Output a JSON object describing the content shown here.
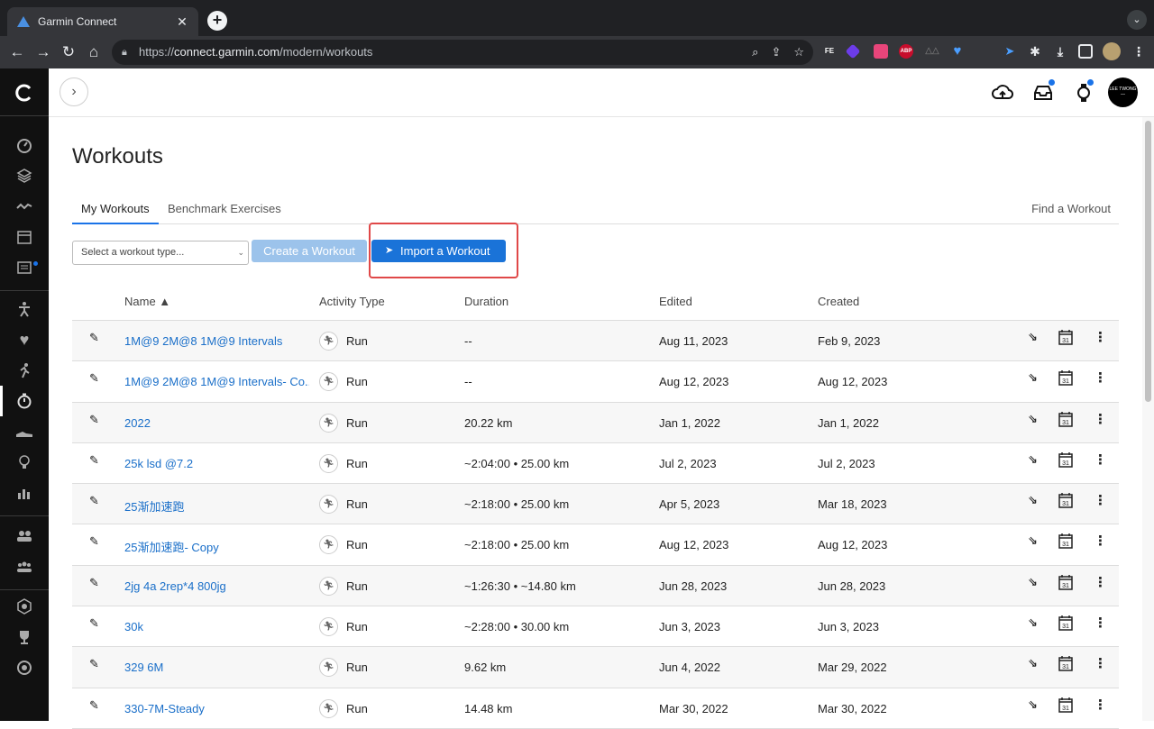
{
  "browser": {
    "tab_title": "Garmin Connect",
    "url_scheme": "https://",
    "url_host": "connect.garmin.com",
    "url_path": "/modern/workouts",
    "extensions": [
      {
        "name": "fe-extension-icon",
        "text": "FE",
        "color": "#d93025"
      },
      {
        "name": "purple-extension-icon",
        "text": "",
        "color": "#6c3ce9"
      },
      {
        "name": "pink-extension-icon",
        "text": "",
        "color": "#e8457a"
      },
      {
        "name": "abp-extension-icon",
        "text": "ABP",
        "color": "#c70d2c"
      }
    ]
  },
  "header": {
    "avatar_text": "LEE TWONG"
  },
  "page": {
    "title": "Workouts",
    "tabs": [
      {
        "label": "My Workouts",
        "active": true
      },
      {
        "label": "Benchmark Exercises",
        "active": false
      }
    ],
    "find_link": "Find a Workout",
    "type_select_placeholder": "Select a workout type...",
    "create_button": "Create a Workout",
    "import_button": "Import a Workout"
  },
  "table": {
    "columns": [
      "Name ▲",
      "Activity Type",
      "Duration",
      "Edited",
      "Created"
    ],
    "rows": [
      {
        "name": "1M@9 2M@8 1M@9 Intervals",
        "activity": "Run",
        "duration": "--",
        "edited": "Aug 11, 2023",
        "created": "Feb 9, 2023"
      },
      {
        "name": "1M@9 2M@8 1M@9 Intervals- Co...",
        "activity": "Run",
        "duration": "--",
        "edited": "Aug 12, 2023",
        "created": "Aug 12, 2023"
      },
      {
        "name": "2022",
        "activity": "Run",
        "duration": "20.22 km",
        "edited": "Jan 1, 2022",
        "created": "Jan 1, 2022"
      },
      {
        "name": "25k lsd @7.2",
        "activity": "Run",
        "duration": "~2:04:00 • 25.00 km",
        "edited": "Jul 2, 2023",
        "created": "Jul 2, 2023"
      },
      {
        "name": "25渐加速跑",
        "activity": "Run",
        "duration": "~2:18:00 • 25.00 km",
        "edited": "Apr 5, 2023",
        "created": "Mar 18, 2023"
      },
      {
        "name": "25渐加速跑- Copy",
        "activity": "Run",
        "duration": "~2:18:00 • 25.00 km",
        "edited": "Aug 12, 2023",
        "created": "Aug 12, 2023"
      },
      {
        "name": "2jg 4a 2rep*4 800jg",
        "activity": "Run",
        "duration": "~1:26:30 • ~14.80 km",
        "edited": "Jun 28, 2023",
        "created": "Jun 28, 2023"
      },
      {
        "name": "30k",
        "activity": "Run",
        "duration": "~2:28:00 • 30.00 km",
        "edited": "Jun 3, 2023",
        "created": "Jun 3, 2023"
      },
      {
        "name": "329 6M",
        "activity": "Run",
        "duration": "9.62 km",
        "edited": "Jun 4, 2022",
        "created": "Mar 29, 2022"
      },
      {
        "name": "330-7M-Steady",
        "activity": "Run",
        "duration": "14.48 km",
        "edited": "Mar 30, 2022",
        "created": "Mar 30, 2022"
      }
    ]
  }
}
